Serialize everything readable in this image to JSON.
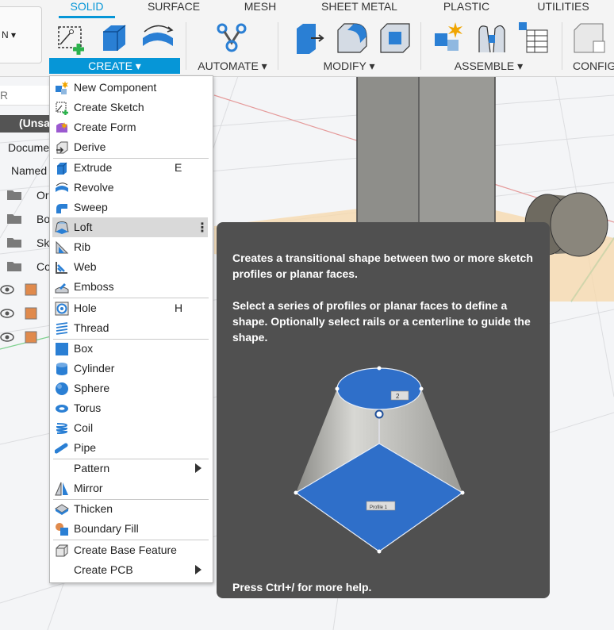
{
  "ribbon": {
    "tabs": [
      {
        "label": "SOLID",
        "active": true
      },
      {
        "label": "SURFACE"
      },
      {
        "label": "MESH"
      },
      {
        "label": "SHEET METAL"
      },
      {
        "label": "PLASTIC"
      },
      {
        "label": "UTILITIES"
      }
    ],
    "groups": [
      {
        "label": "CREATE ▾",
        "active": true
      },
      {
        "label": "AUTOMATE ▾"
      },
      {
        "label": "MODIFY ▾"
      },
      {
        "label": "ASSEMBLE ▾"
      },
      {
        "label": "CONFIG"
      }
    ],
    "left_stub_label": "N ▾",
    "accent": "#0696d7"
  },
  "browser": {
    "search_fragment": "R",
    "doc_fragment": "(Unsa",
    "rows": [
      "Docume",
      "Named",
      "Or",
      "Bo",
      "Sk",
      "Co"
    ]
  },
  "create_menu": {
    "items": [
      {
        "label": "New Component",
        "icon": "new-component-icon"
      },
      {
        "label": "Create Sketch",
        "icon": "create-sketch-icon"
      },
      {
        "label": "Create Form",
        "icon": "create-form-icon"
      },
      {
        "label": "Derive",
        "icon": "derive-icon"
      },
      {
        "label": "Extrude",
        "icon": "extrude-icon",
        "shortcut": "E"
      },
      {
        "label": "Revolve",
        "icon": "revolve-icon"
      },
      {
        "label": "Sweep",
        "icon": "sweep-icon"
      },
      {
        "label": "Loft",
        "icon": "loft-icon",
        "highlighted": true
      },
      {
        "label": "Rib",
        "icon": "rib-icon"
      },
      {
        "label": "Web",
        "icon": "web-icon"
      },
      {
        "label": "Emboss",
        "icon": "emboss-icon"
      },
      {
        "label": "Hole",
        "icon": "hole-icon",
        "shortcut": "H"
      },
      {
        "label": "Thread",
        "icon": "thread-icon"
      },
      {
        "label": "Box",
        "icon": "box-icon"
      },
      {
        "label": "Cylinder",
        "icon": "cylinder-icon"
      },
      {
        "label": "Sphere",
        "icon": "sphere-icon"
      },
      {
        "label": "Torus",
        "icon": "torus-icon"
      },
      {
        "label": "Coil",
        "icon": "coil-icon"
      },
      {
        "label": "Pipe",
        "icon": "pipe-icon"
      },
      {
        "label": "Pattern",
        "icon": "",
        "submenu": true
      },
      {
        "label": "Mirror",
        "icon": "mirror-icon"
      },
      {
        "label": "Thicken",
        "icon": "thicken-icon"
      },
      {
        "label": "Boundary Fill",
        "icon": "boundary-fill-icon"
      },
      {
        "label": "Create Base Feature",
        "icon": "base-feature-icon"
      },
      {
        "label": "Create PCB",
        "icon": "",
        "submenu": true
      }
    ]
  },
  "tooltip": {
    "description": "Creates a transitional shape between two or more sketch profiles or planar faces.",
    "instructions": "Select a series of profiles or planar faces to define a shape. Optionally select rails or a centerline to guide the shape.",
    "illustration_label_top": "2",
    "illustration_label_bottom": "Profile 1",
    "help_hint": "Press Ctrl+/ for more help."
  }
}
